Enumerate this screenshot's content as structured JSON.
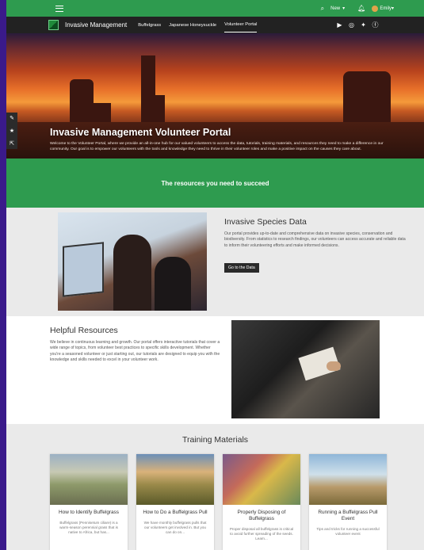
{
  "appbar": {
    "new_label": "New",
    "user_name": "Emily",
    "accent": "#2e9b4f"
  },
  "nav": {
    "brand": "Invasive Management",
    "links": [
      "Buffelgrass",
      "Japanese Honeysuckle",
      "Volunteer Portal"
    ],
    "active_link": "Volunteer Portal",
    "social_icons": [
      "youtube-icon",
      "instagram-icon",
      "twitter-icon",
      "facebook-icon"
    ]
  },
  "hero": {
    "title": "Invasive Management Volunteer Portal",
    "text": "Welcome to the Volunteer Portal, where we provide an all-in-one hub for our valued volunteers to access the data, tutorials, training materials, and resources they need to make a difference in our community. Our goal is to empower our volunteers with the tools and knowledge they need to thrive in their volunteer roles and make a positive impact on the causes they care about."
  },
  "band": {
    "text": "The resources you need to succeed"
  },
  "species": {
    "title": "Invasive Species Data",
    "text": "Our portal provides up-to-date and comprehensive data on invasive species, conservation and biodiversity. From statistics to research findings, our volunteers can access accurate and reliable data to inform their volunteering efforts and make informed decisions.",
    "button": "Go to the Data"
  },
  "helpful": {
    "title": "Helpful Resources",
    "text": "We believe in continuous learning and growth. Our portal offers interactive tutorials that cover a wide range of topics, from volunteer best practices to specific skills development. Whether you're a seasoned volunteer or just starting out, our tutorials are designed to equip you with the knowledge and skills needed to excel in your volunteer work."
  },
  "training": {
    "title": "Training Materials",
    "cards": [
      {
        "title": "How to Identify Buffelgrass",
        "desc": "Buffelgrass (Pennisetum ciliare) is a warm-season perennial grass that is native to Africa, but has..."
      },
      {
        "title": "How to Do a Buffelgrass Pull",
        "desc": "We have monthly buffelgrass pulls that our volunteers get involved in. But you can do on..."
      },
      {
        "title": "Properly Disposing of Buffelgrass",
        "desc": "Proper disposal all buffelgrass is critical to avoid further spreading of the seeds. Learn..."
      },
      {
        "title": "Running a Buffelgrass Pull Event",
        "desc": "Tips and tricks for running a successful volunteer event"
      }
    ]
  }
}
